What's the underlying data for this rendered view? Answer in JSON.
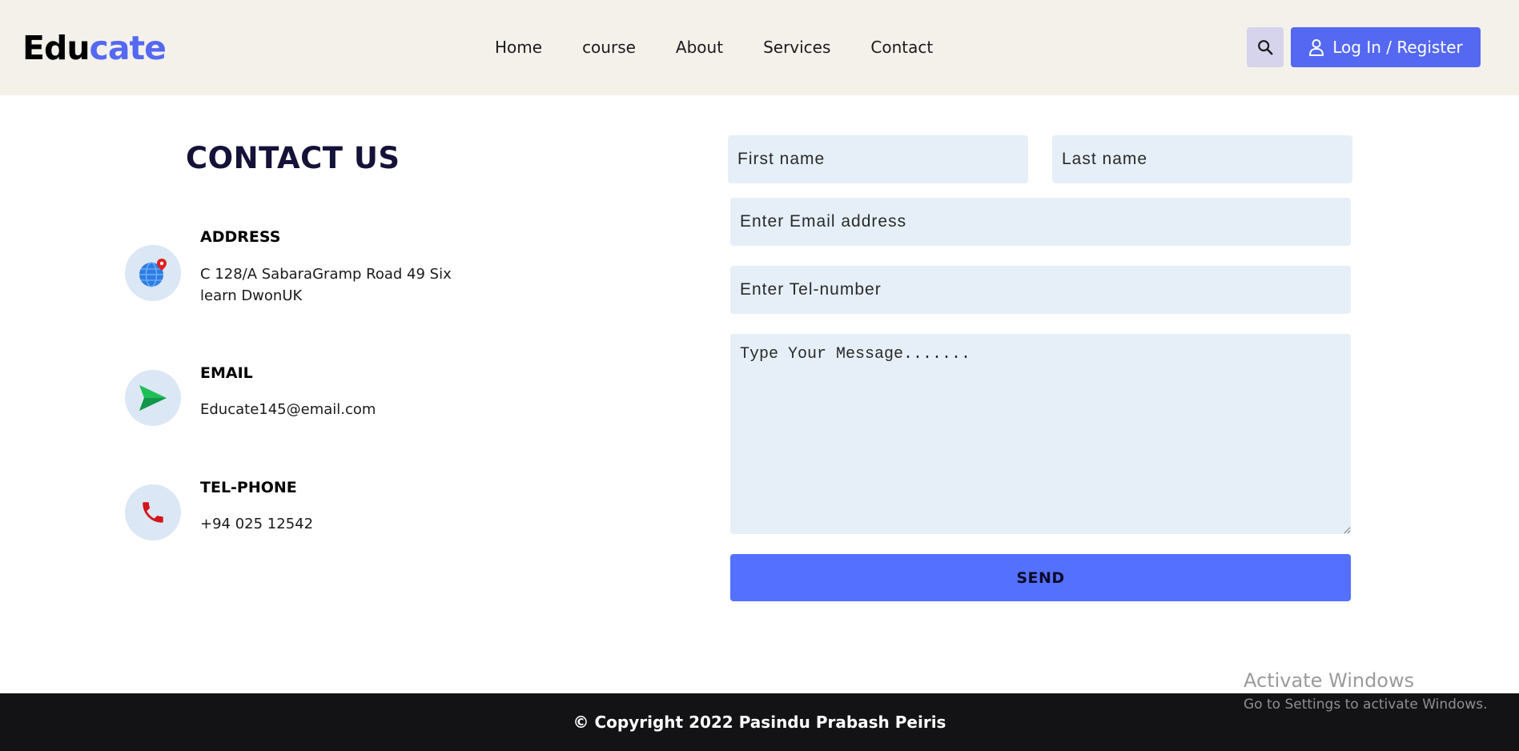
{
  "brand": {
    "part1": "Edu",
    "part2": "cate",
    "accent_color": "#5468f2"
  },
  "nav": {
    "items": [
      {
        "label": "Home"
      },
      {
        "label": "course"
      },
      {
        "label": "About"
      },
      {
        "label": "Services"
      },
      {
        "label": "Contact"
      }
    ]
  },
  "header": {
    "search_icon": "search-icon",
    "login_label": "Log In / Register",
    "login_icon": "user-icon"
  },
  "contact": {
    "title": "CONTACT US",
    "address": {
      "heading": "ADDRESS",
      "line1": "C 128/A SabaraGramp Road 49 Six",
      "line2": "learn DwonUK",
      "icon": "globe-pin-icon"
    },
    "email": {
      "heading": "EMAIL",
      "value": "Educate145@email.com",
      "icon": "send-icon"
    },
    "phone": {
      "heading": "TEL-PHONE",
      "value": "+94 025 12542",
      "icon": "phone-icon"
    }
  },
  "form": {
    "first_name_placeholder": "First name",
    "last_name_placeholder": "Last name",
    "email_placeholder": "Enter Email address",
    "tel_placeholder": "Enter Tel-number",
    "message_placeholder": "Type Your Message.......",
    "send_label": "SEND"
  },
  "watermark": {
    "title": "Activate Windows",
    "subtitle": "Go to Settings to activate Windows."
  },
  "footer": {
    "copyright": "© Copyright 2022 Pasindu Prabash Peiris"
  }
}
